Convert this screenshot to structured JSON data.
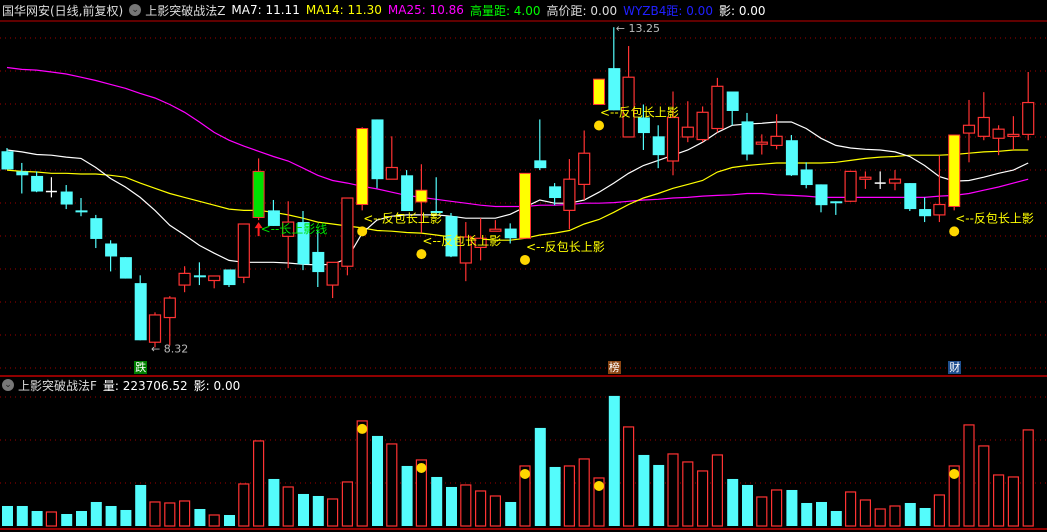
{
  "header": {
    "title": "国华网安(日线,前复权)",
    "indicator": "上影突破战法Z",
    "ma7": "MA7: 11.11",
    "ma14": "MA14: 11.30",
    "ma25": "MA25: 10.86",
    "gaoliangju": "高量距: 4.00",
    "gaojiaju": "高价距: 0.00",
    "wyzb4": "WYZB4距: 0.00",
    "ying": "影: 0.00"
  },
  "volume_header": {
    "indicator": "上影突破战法F",
    "volume": "量: 223706.52",
    "ying": "影: 0.00"
  },
  "colors": {
    "up": "#ff3333",
    "down": "#54fcfc",
    "highlight": "#ffff00",
    "flag_green": "#00e000",
    "ma7": "#ffffff",
    "ma14": "#ffff00",
    "ma25": "#ff00ff",
    "grid": "#a00000",
    "gaoliangju": "#00ff00",
    "wyzb4": "#2020ff",
    "dot": "#ffd700"
  },
  "icons": {
    "indicator_menu": "chevron-down-circle-icon"
  },
  "chart_data": {
    "type": "candlestick",
    "ylim": [
      7.88,
      13.33
    ],
    "grid": true,
    "candles": [
      [
        11.34,
        11.39,
        11.06,
        11.06
      ],
      [
        11.03,
        11.16,
        10.69,
        10.97
      ],
      [
        10.96,
        11.03,
        10.71,
        10.72
      ],
      [
        10.72,
        10.94,
        10.63,
        10.72
      ],
      [
        10.72,
        10.82,
        10.45,
        10.52
      ],
      [
        10.43,
        10.62,
        10.34,
        10.42
      ],
      [
        10.31,
        10.36,
        9.85,
        9.99
      ],
      [
        9.92,
        9.97,
        9.49,
        9.72
      ],
      [
        9.71,
        9.71,
        9.38,
        9.38
      ],
      [
        9.31,
        9.43,
        8.43,
        8.43
      ],
      [
        8.4,
        8.86,
        8.32,
        8.82
      ],
      [
        8.78,
        9.11,
        8.35,
        9.08
      ],
      [
        9.28,
        9.57,
        9.17,
        9.46
      ],
      [
        9.43,
        9.63,
        9.28,
        9.42
      ],
      [
        9.35,
        9.42,
        9.23,
        9.42
      ],
      [
        9.52,
        9.52,
        9.25,
        9.28
      ],
      [
        9.4,
        10.22,
        9.31,
        10.22
      ],
      [
        11.03,
        11.23,
        10.28,
        10.32
      ],
      [
        10.43,
        10.59,
        10.19,
        10.19
      ],
      [
        10.03,
        10.57,
        9.54,
        10.25
      ],
      [
        10.25,
        10.42,
        9.51,
        9.6
      ],
      [
        9.79,
        10.12,
        9.25,
        9.48
      ],
      [
        9.28,
        9.63,
        9.08,
        9.63
      ],
      [
        9.57,
        10.62,
        9.43,
        10.62
      ],
      [
        10.52,
        11.71,
        10.43,
        11.69
      ],
      [
        11.83,
        11.83,
        10.77,
        10.91
      ],
      [
        10.91,
        11.57,
        10.91,
        11.09
      ],
      [
        10.97,
        11.05,
        10.42,
        10.42
      ],
      [
        10.56,
        11.14,
        10.08,
        10.74
      ],
      [
        10.42,
        10.94,
        10.37,
        10.4
      ],
      [
        10.34,
        10.39,
        9.71,
        9.72
      ],
      [
        9.62,
        10.25,
        9.34,
        10.02
      ],
      [
        9.86,
        10.31,
        9.66,
        10.0
      ],
      [
        10.13,
        10.28,
        10.13,
        10.14
      ],
      [
        10.15,
        10.23,
        9.92,
        10.0
      ],
      [
        10.0,
        11.0,
        9.99,
        11.0
      ],
      [
        11.2,
        11.83,
        11.05,
        11.08
      ],
      [
        10.8,
        10.85,
        10.51,
        10.62
      ],
      [
        10.43,
        11.22,
        10.14,
        10.91
      ],
      [
        10.83,
        11.66,
        10.59,
        11.31
      ],
      [
        12.06,
        12.45,
        12.06,
        12.45
      ],
      [
        12.62,
        13.25,
        11.97,
        11.97
      ],
      [
        11.56,
        12.96,
        11.56,
        12.48
      ],
      [
        11.86,
        12.06,
        11.36,
        11.62
      ],
      [
        11.57,
        11.74,
        11.08,
        11.28
      ],
      [
        11.19,
        12.26,
        10.97,
        11.86
      ],
      [
        11.56,
        12.11,
        11.48,
        11.71
      ],
      [
        11.52,
        12.03,
        11.48,
        11.94
      ],
      [
        11.69,
        12.47,
        11.63,
        12.34
      ],
      [
        12.26,
        12.26,
        11.74,
        11.96
      ],
      [
        11.8,
        11.93,
        11.2,
        11.29
      ],
      [
        11.45,
        11.6,
        11.29,
        11.48
      ],
      [
        11.43,
        11.91,
        11.37,
        11.57
      ],
      [
        11.51,
        11.59,
        10.96,
        10.97
      ],
      [
        11.06,
        11.17,
        10.77,
        10.82
      ],
      [
        10.83,
        10.83,
        10.4,
        10.51
      ],
      [
        10.57,
        10.57,
        10.36,
        10.56
      ],
      [
        10.57,
        11.03,
        10.56,
        11.03
      ],
      [
        10.91,
        11.03,
        10.76,
        10.94
      ],
      [
        10.85,
        11.03,
        10.76,
        10.85
      ],
      [
        10.85,
        11.05,
        10.74,
        10.91
      ],
      [
        10.85,
        10.85,
        10.42,
        10.45
      ],
      [
        10.45,
        10.63,
        10.25,
        10.34
      ],
      [
        10.36,
        11.28,
        10.25,
        10.52
      ],
      [
        10.49,
        11.59,
        10.43,
        11.59
      ],
      [
        11.62,
        12.13,
        11.17,
        11.74
      ],
      [
        11.57,
        12.25,
        11.51,
        11.86
      ],
      [
        11.54,
        11.74,
        11.28,
        11.68
      ],
      [
        11.57,
        11.88,
        11.36,
        11.6
      ],
      [
        11.6,
        12.56,
        11.51,
        12.09
      ]
    ],
    "ma7": [
      11.36,
      11.33,
      11.29,
      11.28,
      11.25,
      11.23,
      11.09,
      10.92,
      10.79,
      10.63,
      10.43,
      10.2,
      10.05,
      9.89,
      9.77,
      9.66,
      9.63,
      9.63,
      9.63,
      9.62,
      9.6,
      9.59,
      9.6,
      9.69,
      10.08,
      10.28,
      10.34,
      10.36,
      10.36,
      10.36,
      10.34,
      10.31,
      10.31,
      10.31,
      10.37,
      10.48,
      10.59,
      10.54,
      10.54,
      10.59,
      10.71,
      10.85,
      11.0,
      11.12,
      11.2,
      11.28,
      11.36,
      11.48,
      11.63,
      11.74,
      11.76,
      11.77,
      11.79,
      11.79,
      11.69,
      11.54,
      11.43,
      11.39,
      11.37,
      11.36,
      11.33,
      11.26,
      11.12,
      10.95,
      10.88,
      10.89,
      10.94,
      11.0,
      11.05,
      11.16
    ],
    "ma14": [
      11.05,
      11.03,
      11.02,
      11.0,
      11.0,
      10.99,
      10.99,
      10.97,
      10.94,
      10.85,
      10.77,
      10.69,
      10.63,
      10.57,
      10.51,
      10.45,
      10.43,
      10.43,
      10.4,
      10.36,
      10.31,
      10.25,
      10.22,
      10.19,
      10.16,
      10.12,
      10.11,
      10.09,
      10.08,
      10.05,
      10.02,
      10.0,
      9.99,
      9.97,
      9.97,
      10.0,
      10.05,
      10.08,
      10.12,
      10.22,
      10.29,
      10.4,
      10.52,
      10.62,
      10.69,
      10.77,
      10.83,
      10.89,
      11.02,
      11.09,
      11.12,
      11.14,
      11.16,
      11.16,
      11.16,
      11.16,
      11.17,
      11.2,
      11.23,
      11.25,
      11.26,
      11.28,
      11.28,
      11.28,
      11.29,
      11.31,
      11.33,
      11.34,
      11.36,
      11.36
    ],
    "ma25": [
      12.63,
      12.6,
      12.59,
      12.56,
      12.53,
      12.48,
      12.43,
      12.37,
      12.31,
      12.23,
      12.16,
      12.06,
      11.94,
      11.79,
      11.63,
      11.51,
      11.42,
      11.34,
      11.26,
      11.19,
      11.08,
      10.97,
      10.89,
      10.85,
      10.8,
      10.76,
      10.71,
      10.66,
      10.63,
      10.6,
      10.57,
      10.54,
      10.51,
      10.49,
      10.49,
      10.49,
      10.51,
      10.51,
      10.52,
      10.54,
      10.54,
      10.55,
      10.57,
      10.59,
      10.6,
      10.62,
      10.63,
      10.65,
      10.66,
      10.67,
      10.69,
      10.69,
      10.67,
      10.66,
      10.65,
      10.63,
      10.63,
      10.63,
      10.63,
      10.63,
      10.63,
      10.63,
      10.63,
      10.65,
      10.66,
      10.69,
      10.74,
      10.79,
      10.85,
      10.91
    ],
    "volume_ylim": [
      0,
      312000
    ],
    "volume": [
      46600,
      46600,
      34950,
      32620,
      27960,
      34950,
      55920,
      46600,
      37280,
      95530,
      55920,
      53590,
      58250,
      39610,
      25630,
      25630,
      97860,
      198050,
      109510,
      90870,
      74560,
      69900,
      62910,
      102520,
      244650,
      209700,
      191060,
      139800,
      153780,
      114170,
      90870,
      95530,
      81550,
      69900,
      55920,
      139800,
      228340,
      137470,
      139800,
      156110,
      111840,
      302900,
      230670,
      165430,
      142130,
      167760,
      149120,
      128150,
      165430,
      109510,
      95530,
      67570,
      83880,
      83880,
      53590,
      55920,
      34950,
      79220,
      60580,
      39610,
      46600,
      53590,
      41940,
      72230,
      139800,
      235330,
      186400,
      118830,
      114170,
      223707
    ],
    "highlight_candles": [
      25,
      29,
      36,
      41,
      65
    ],
    "green_flag_candle": 18,
    "signal_label": "<--反包长上影",
    "shadow_label": "<--长上影线",
    "high_label": "13.25",
    "low_label": "8.32",
    "high_candle": 42,
    "low_candle": 11,
    "markers": [
      {
        "candle": 10,
        "text": "跌",
        "color": "#008000"
      },
      {
        "candle": 42,
        "text": "榜",
        "color": "#8b4513"
      },
      {
        "candle": 65,
        "text": "财",
        "color": "#1f4f8f"
      }
    ]
  }
}
